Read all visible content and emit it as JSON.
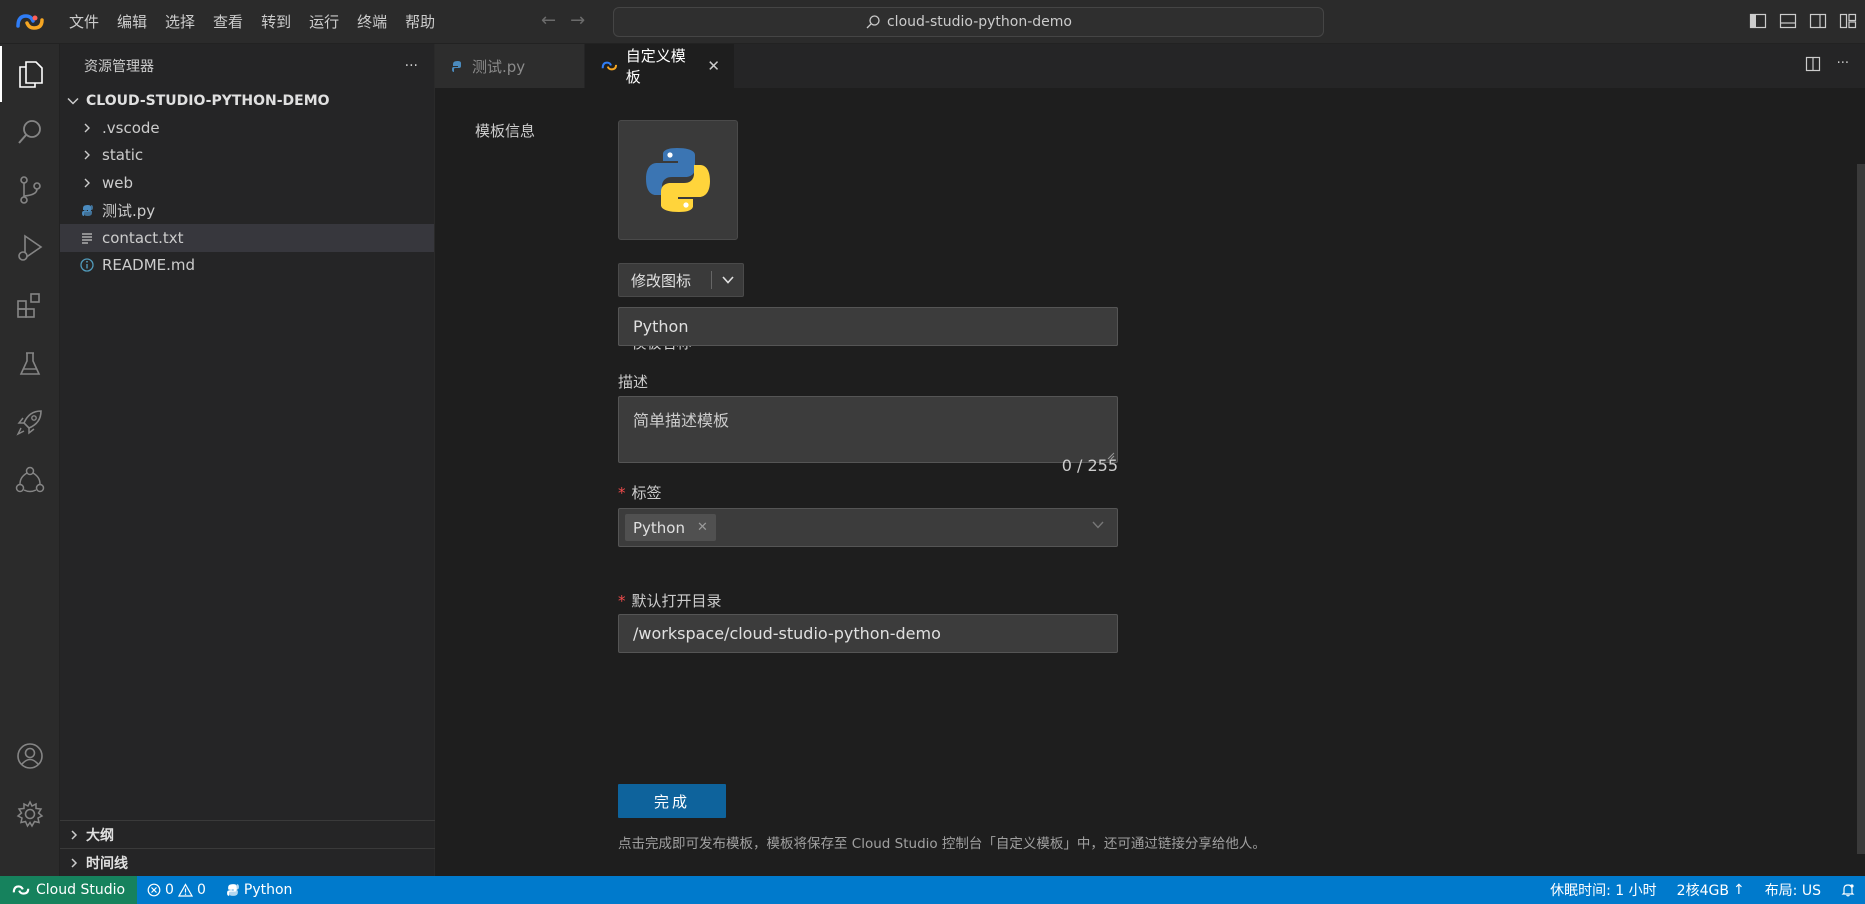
{
  "titlebar": {
    "menu": [
      "文件",
      "编辑",
      "选择",
      "查看",
      "转到",
      "运行",
      "终端",
      "帮助"
    ],
    "command_center": "cloud-studio-python-demo"
  },
  "sidebar": {
    "title": "资源管理器",
    "more": "···",
    "root": "CLOUD-STUDIO-PYTHON-DEMO",
    "items": [
      {
        "label": ".vscode",
        "kind": "folder"
      },
      {
        "label": "static",
        "kind": "folder"
      },
      {
        "label": "web",
        "kind": "folder"
      },
      {
        "label": "测试.py",
        "kind": "python"
      },
      {
        "label": "contact.txt",
        "kind": "text"
      },
      {
        "label": "README.md",
        "kind": "info"
      }
    ],
    "outline": "大纲",
    "timeline": "时间线"
  },
  "tabs": [
    {
      "label": "测试.py",
      "active": false
    },
    {
      "label": "自定义模板",
      "active": true
    }
  ],
  "editor_more": "···",
  "form": {
    "section_label": "模板信息",
    "change_icon": "修改图标",
    "name_label": "模板名称",
    "name_value": "Python",
    "desc_label": "描述",
    "desc_placeholder": "简单描述模板",
    "desc_counter": "0 / 255",
    "tags_label": "标签",
    "tag_value": "Python",
    "dir_label": "默认打开目录",
    "dir_value": "/workspace/cloud-studio-python-demo",
    "submit": "完成",
    "hint": "点击完成即可发布模板，模板将保存至 Cloud Studio 控制台「自定义模板」中，还可通过链接分享给他人。"
  },
  "statusbar": {
    "remote": "Cloud Studio",
    "errors": "0",
    "warnings": "0",
    "language": "Python",
    "sleep": "休眠时间: 1 小时",
    "spec": "2核4GB",
    "layout": "布局: US"
  },
  "colors": {
    "accent": "#007acc",
    "remote": "#16825d",
    "primary_button": "#0e639c",
    "required": "#f14c4c"
  }
}
